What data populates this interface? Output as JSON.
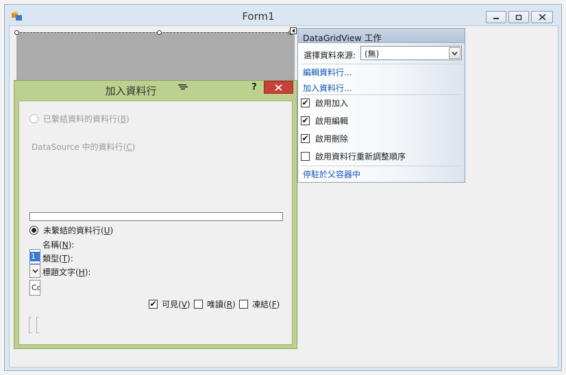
{
  "form": {
    "title": "Form1",
    "minimize_icon": "minimize-icon",
    "maximize_icon": "maximize-icon",
    "close_icon": "close-icon"
  },
  "task_panel": {
    "header": "DataGridView 工作",
    "datasource_label": "選擇資料來源:",
    "datasource_value": "(無)",
    "edit_columns_link": "編輯資料行...",
    "add_column_link": "加入資料行...",
    "checkboxes": [
      {
        "label": "啟用加入",
        "checked": true
      },
      {
        "label": "啟用編輯",
        "checked": true
      },
      {
        "label": "啟用刪除",
        "checked": true
      },
      {
        "label": "啟用資料行重新調整順序",
        "checked": false
      }
    ],
    "dock_link": "停駐於父容器中"
  },
  "dialog": {
    "title": "加入資料行",
    "help_label": "?",
    "bound_radio": {
      "text": "已繫結資料的資料行",
      "mnemonic": "B",
      "selected": false
    },
    "datasource_columns_label": {
      "text": "DataSource 中的資料行",
      "mnemonic": "C"
    },
    "unbound_radio": {
      "text": "未繫結的資料行",
      "mnemonic": "U",
      "selected": true
    },
    "name_label": {
      "text": "名稱",
      "mnemonic": "N"
    },
    "type_label": {
      "text": "類型",
      "mnemonic": "T"
    },
    "header_text_label": {
      "text": "標題文字",
      "mnemonic": "H"
    },
    "name_value": "1",
    "header_text_value": "Co",
    "visible_check": {
      "text": "可見",
      "mnemonic": "V",
      "checked": true
    },
    "readonly_check": {
      "text": "唯讀",
      "mnemonic": "R",
      "checked": false
    },
    "frozen_check": {
      "text": "凍結",
      "mnemonic": "F",
      "checked": false
    }
  },
  "colors": {
    "dialog_frame": "#bcd18f",
    "close_button": "#c7413b",
    "link": "#0d52b9",
    "grid_background": "#ababab"
  }
}
